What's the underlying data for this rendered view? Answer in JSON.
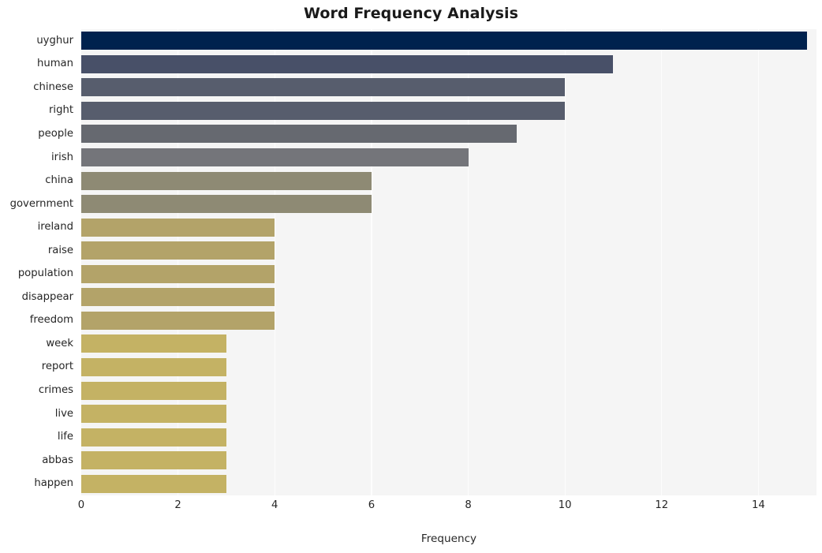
{
  "chart_data": {
    "type": "bar",
    "orientation": "horizontal",
    "title": "Word Frequency Analysis",
    "xlabel": "Frequency",
    "ylabel": "",
    "xlim": [
      0,
      15.2
    ],
    "ylim": [
      0,
      20
    ],
    "grid": true,
    "grid_axis": "x",
    "legend": null,
    "colormap": "cividis",
    "plot_background": "#f5f5f5",
    "grid_color": "#fdfdfd",
    "figure_background": "#ffffff",
    "xticks": [
      0,
      2,
      4,
      6,
      8,
      10,
      12,
      14
    ],
    "xtick_labels": [
      "0",
      "2",
      "4",
      "6",
      "8",
      "10",
      "12",
      "14"
    ],
    "categories": [
      "uyghur",
      "human",
      "chinese",
      "right",
      "people",
      "irish",
      "china",
      "government",
      "ireland",
      "raise",
      "population",
      "disappear",
      "freedom",
      "week",
      "report",
      "crimes",
      "live",
      "life",
      "abbas",
      "happen"
    ],
    "values": [
      15,
      11,
      10,
      10,
      9,
      8,
      6,
      6,
      4,
      4,
      4,
      4,
      4,
      3,
      3,
      3,
      3,
      3,
      3,
      3
    ],
    "bar_colors": [
      "#00224e",
      "#485068",
      "#575d6d",
      "#575d6d",
      "#666970",
      "#74757a",
      "#8e8a74",
      "#8e8a74",
      "#b3a369",
      "#b3a369",
      "#b3a369",
      "#b3a369",
      "#b3a369",
      "#c4b264",
      "#c4b264",
      "#c4b264",
      "#c4b264",
      "#c4b264",
      "#c4b264",
      "#c4b264"
    ],
    "bars": [
      {
        "label": "uyghur",
        "value": 15,
        "color": "#00224e"
      },
      {
        "label": "human",
        "value": 11,
        "color": "#485068"
      },
      {
        "label": "chinese",
        "value": 10,
        "color": "#575d6d"
      },
      {
        "label": "right",
        "value": 10,
        "color": "#575d6d"
      },
      {
        "label": "people",
        "value": 9,
        "color": "#666970"
      },
      {
        "label": "irish",
        "value": 8,
        "color": "#74757a"
      },
      {
        "label": "china",
        "value": 6,
        "color": "#8e8a74"
      },
      {
        "label": "government",
        "value": 6,
        "color": "#8e8a74"
      },
      {
        "label": "ireland",
        "value": 4,
        "color": "#b3a369"
      },
      {
        "label": "raise",
        "value": 4,
        "color": "#b3a369"
      },
      {
        "label": "population",
        "value": 4,
        "color": "#b3a369"
      },
      {
        "label": "disappear",
        "value": 4,
        "color": "#b3a369"
      },
      {
        "label": "freedom",
        "value": 4,
        "color": "#b3a369"
      },
      {
        "label": "week",
        "value": 3,
        "color": "#c4b264"
      },
      {
        "label": "report",
        "value": 3,
        "color": "#c4b264"
      },
      {
        "label": "crimes",
        "value": 3,
        "color": "#c4b264"
      },
      {
        "label": "live",
        "value": 3,
        "color": "#c4b264"
      },
      {
        "label": "life",
        "value": 3,
        "color": "#c4b264"
      },
      {
        "label": "abbas",
        "value": 3,
        "color": "#c4b264"
      },
      {
        "label": "happen",
        "value": 3,
        "color": "#c4b264"
      }
    ]
  }
}
